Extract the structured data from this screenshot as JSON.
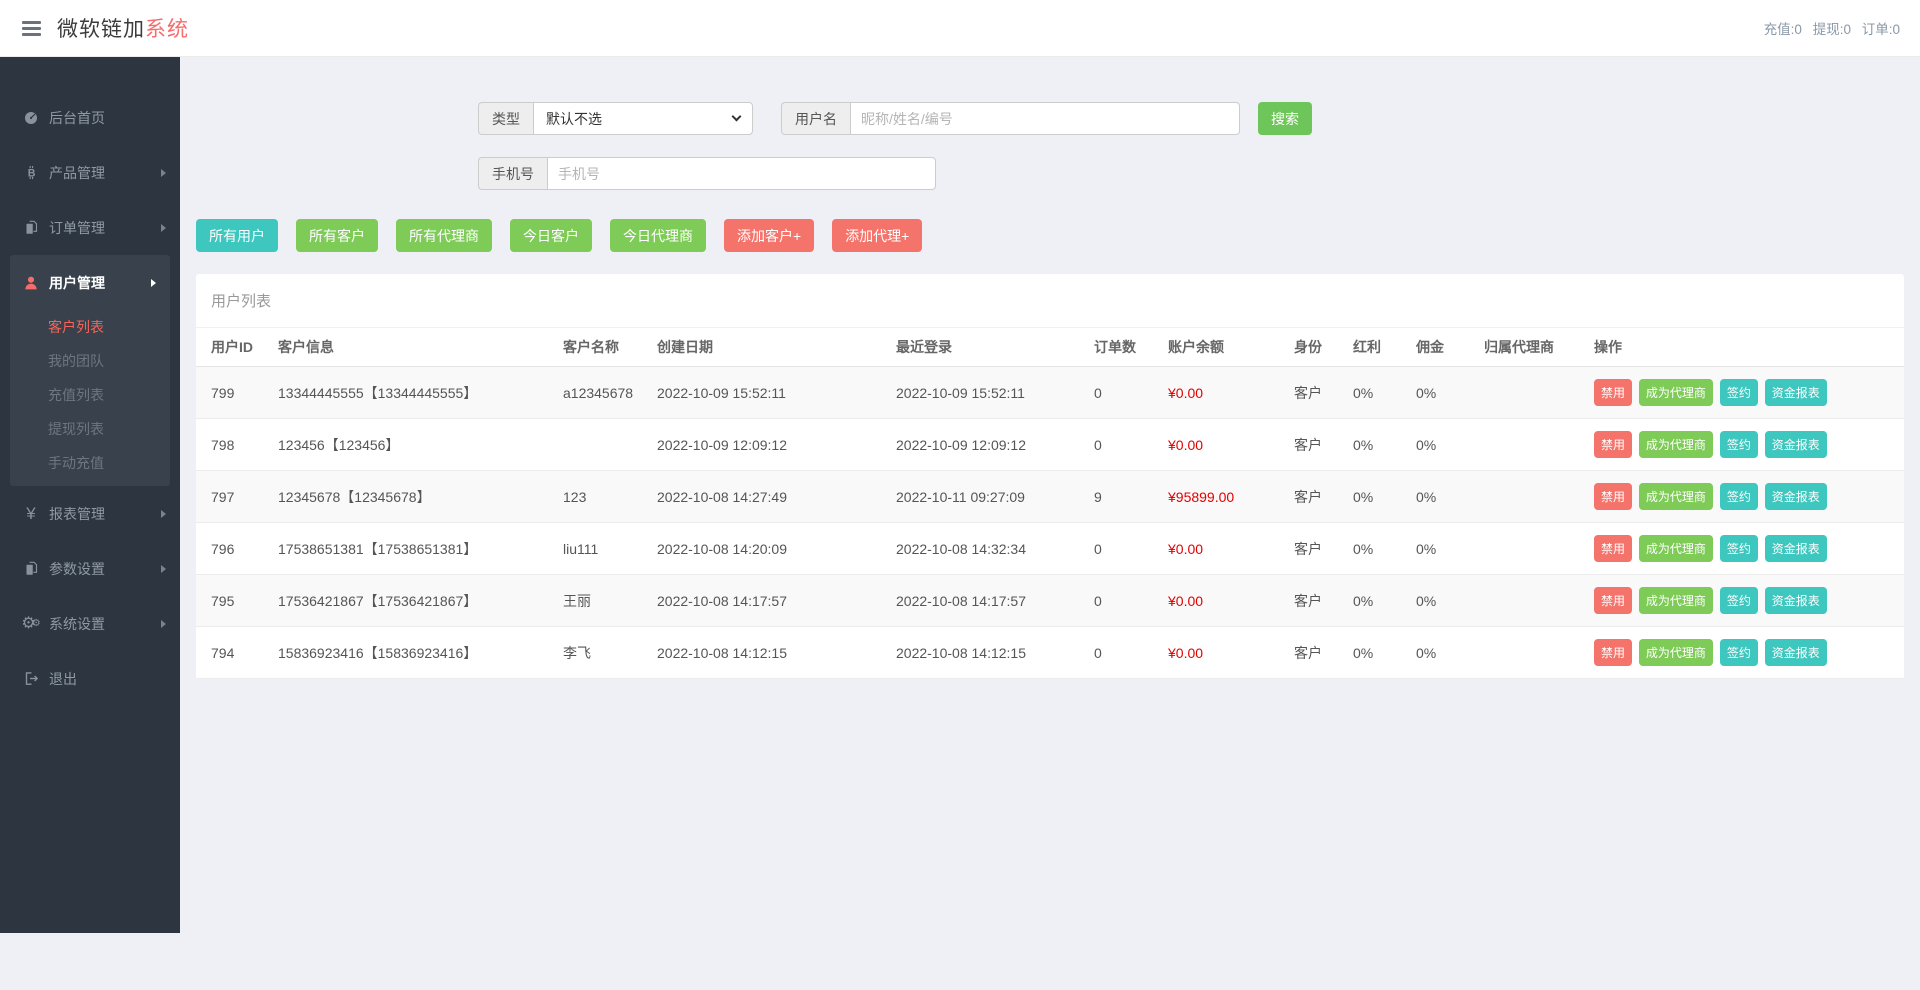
{
  "header": {
    "logo_main": "微软链加",
    "logo_accent": "系统",
    "stats": [
      "充值:0",
      "提现:0",
      "订单:0"
    ]
  },
  "sidebar": {
    "items": [
      {
        "icon": "dashboard-icon",
        "label": "后台首页"
      },
      {
        "icon": "bitcoin-icon",
        "label": "产品管理"
      },
      {
        "icon": "files-icon",
        "label": "订单管理"
      },
      {
        "icon": "user-icon",
        "label": "用户管理",
        "active": true,
        "children": [
          {
            "label": "客户列表",
            "active": true
          },
          {
            "label": "我的团队"
          },
          {
            "label": "充值列表"
          },
          {
            "label": "提现列表"
          },
          {
            "label": "手动充值"
          }
        ]
      },
      {
        "icon": "yen-icon",
        "label": "报表管理"
      },
      {
        "icon": "files-icon",
        "label": "参数设置"
      },
      {
        "icon": "gears-icon",
        "label": "系统设置"
      },
      {
        "icon": "logout-icon",
        "label": "退出"
      }
    ]
  },
  "search": {
    "type_label": "类型",
    "type_value": "默认不选",
    "username_label": "用户名",
    "username_placeholder": "昵称/姓名/编号",
    "search_button": "搜索",
    "phone_label": "手机号",
    "phone_placeholder": "手机号"
  },
  "toolbar": {
    "buttons": [
      {
        "label": "所有用户",
        "style": "teal"
      },
      {
        "label": "所有客户",
        "style": "green"
      },
      {
        "label": "所有代理商",
        "style": "green"
      },
      {
        "label": "今日客户",
        "style": "green"
      },
      {
        "label": "今日代理商",
        "style": "green"
      },
      {
        "label": "添加客户+",
        "style": "red"
      },
      {
        "label": "添加代理+",
        "style": "red"
      }
    ]
  },
  "table": {
    "title": "用户列表",
    "columns": [
      "用户ID",
      "客户信息",
      "客户名称",
      "创建日期",
      "最近登录",
      "订单数",
      "账户余额",
      "身份",
      "红利",
      "佣金",
      "归属代理商",
      "操作"
    ],
    "actions": [
      "禁用",
      "成为代理商",
      "签约",
      "资金报表"
    ],
    "rows": [
      {
        "id": "799",
        "info": "13344445555【13344445555】",
        "name": "a12345678",
        "created": "2022-10-09 15:52:11",
        "last_login": "2022-10-09 15:52:11",
        "orders": "0",
        "balance": "¥0.00",
        "role": "客户",
        "bonus": "0%",
        "commission": "0%",
        "agent": ""
      },
      {
        "id": "798",
        "info": "123456【123456】",
        "name": "",
        "created": "2022-10-09 12:09:12",
        "last_login": "2022-10-09 12:09:12",
        "orders": "0",
        "balance": "¥0.00",
        "role": "客户",
        "bonus": "0%",
        "commission": "0%",
        "agent": ""
      },
      {
        "id": "797",
        "info": "12345678【12345678】",
        "name": "123",
        "created": "2022-10-08 14:27:49",
        "last_login": "2022-10-11 09:27:09",
        "orders": "9",
        "balance": "¥95899.00",
        "role": "客户",
        "bonus": "0%",
        "commission": "0%",
        "agent": ""
      },
      {
        "id": "796",
        "info": "17538651381【17538651381】",
        "name": "liu111",
        "created": "2022-10-08 14:20:09",
        "last_login": "2022-10-08 14:32:34",
        "orders": "0",
        "balance": "¥0.00",
        "role": "客户",
        "bonus": "0%",
        "commission": "0%",
        "agent": ""
      },
      {
        "id": "795",
        "info": "17536421867【17536421867】",
        "name": "王丽",
        "created": "2022-10-08 14:17:57",
        "last_login": "2022-10-08 14:17:57",
        "orders": "0",
        "balance": "¥0.00",
        "role": "客户",
        "bonus": "0%",
        "commission": "0%",
        "agent": ""
      },
      {
        "id": "794",
        "info": "15836923416【15836923416】",
        "name": "李飞",
        "created": "2022-10-08 14:12:15",
        "last_login": "2022-10-08 14:12:15",
        "orders": "0",
        "balance": "¥0.00",
        "role": "客户",
        "bonus": "0%",
        "commission": "0%",
        "agent": ""
      }
    ]
  },
  "colors": {
    "accent_red": "#f56c6c",
    "active_menu_red": "#f5645a",
    "teal": "#3dc7be",
    "green": "#7ecb58",
    "salmon": "#f4736b",
    "balance_red": "#e60000",
    "sidebar_bg": "#2c3540",
    "sidebar_group_bg": "#38414c"
  }
}
